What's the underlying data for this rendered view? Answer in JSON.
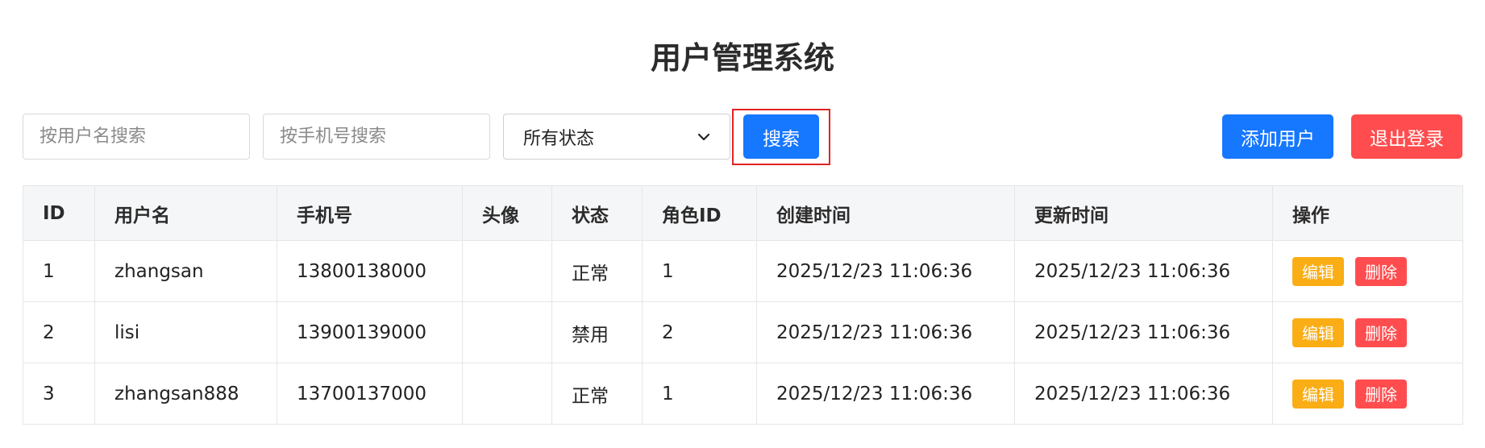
{
  "page_title": "用户管理系统",
  "search": {
    "username_placeholder": "按用户名搜索",
    "phone_placeholder": "按手机号搜索",
    "status_selected": "所有状态",
    "search_label": "搜索"
  },
  "actions": {
    "add_label": "添加用户",
    "logout_label": "退出登录"
  },
  "colors": {
    "primary": "#1677ff",
    "danger": "#ff4d4f",
    "warning": "#faad14",
    "highlight": "#e02424"
  },
  "table": {
    "headers": [
      "ID",
      "用户名",
      "手机号",
      "头像",
      "状态",
      "角色ID",
      "创建时间",
      "更新时间",
      "操作"
    ],
    "rows": [
      {
        "id": "1",
        "username": "zhangsan",
        "phone": "13800138000",
        "avatar": "",
        "status": "正常",
        "role_id": "1",
        "created": "2025/12/23 11:06:36",
        "updated": "2025/12/23 11:06:36",
        "edit": "编辑",
        "delete": "删除"
      },
      {
        "id": "2",
        "username": "lisi",
        "phone": "13900139000",
        "avatar": "",
        "status": "禁用",
        "role_id": "2",
        "created": "2025/12/23 11:06:36",
        "updated": "2025/12/23 11:06:36",
        "edit": "编辑",
        "delete": "删除"
      },
      {
        "id": "3",
        "username": "zhangsan888",
        "phone": "13700137000",
        "avatar": "",
        "status": "正常",
        "role_id": "1",
        "created": "2025/12/23 11:06:36",
        "updated": "2025/12/23 11:06:36",
        "edit": "编辑",
        "delete": "删除"
      }
    ]
  }
}
